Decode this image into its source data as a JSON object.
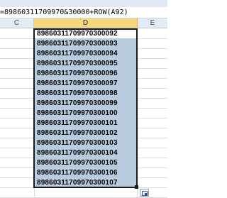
{
  "formula_bar": {
    "text": "=89860311709970&30000+ROW(A92)"
  },
  "columns": [
    {
      "label": "C",
      "active": false
    },
    {
      "label": "D",
      "active": true
    },
    {
      "label": "E",
      "active": false
    }
  ],
  "cells": [
    "89860311709970300092",
    "89860311709970300093",
    "89860311709970300094",
    "89860311709970300095",
    "89860311709970300096",
    "89860311709970300097",
    "89860311709970300098",
    "89860311709970300099",
    "89860311709970300100",
    "89860311709970300101",
    "89860311709970300102",
    "89860311709970300103",
    "89860311709970300104",
    "89860311709970300105",
    "89860311709970300106",
    "89860311709970300107"
  ],
  "autofill_options": {
    "icon": "autofill-options-icon"
  },
  "colors": {
    "selection": "#b9ccdf",
    "active_header": "#f6d77b"
  }
}
